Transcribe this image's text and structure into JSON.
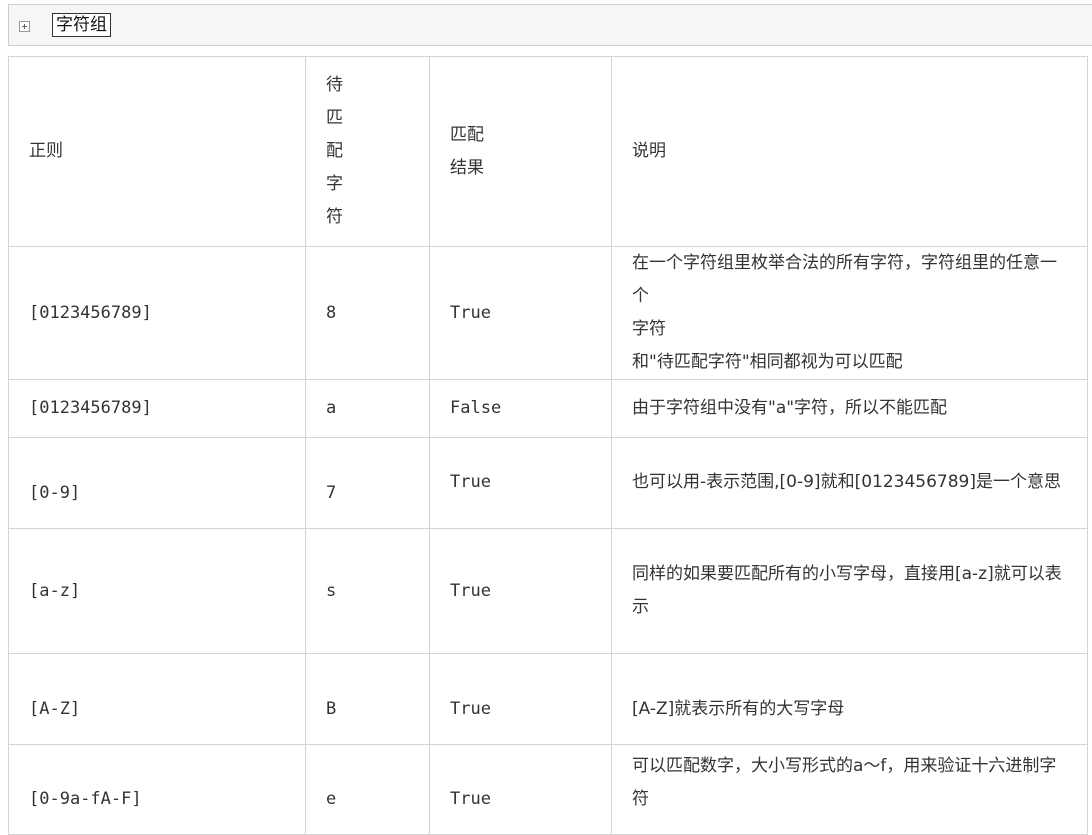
{
  "header": {
    "group_label": "字符组"
  },
  "table": {
    "headers": {
      "pattern": "正则",
      "char_chars": [
        "待",
        "匹",
        "配",
        "字",
        "符"
      ],
      "result_line1": "匹配",
      "result_line2": "结果",
      "description": "说明"
    },
    "rows": [
      {
        "pattern": "[0123456789]",
        "char": "8",
        "result": "True",
        "desc_lines": [
          "在一个字符组里枚举合法的所有字符，字符组里的任意一个",
          "字符",
          "和\"待匹配字符\"相同都视为可以匹配"
        ]
      },
      {
        "pattern": "[0123456789]",
        "char": "a",
        "result": "False",
        "desc_lines": [
          "由于字符组中没有\"a\"字符，所以不能匹配"
        ]
      },
      {
        "pattern": "[0-9]",
        "char": "7",
        "result": "True",
        "desc_lines": [
          "也可以用-表示范围,[0-9]就和[0123456789]是一个意思"
        ]
      },
      {
        "pattern": "[a-z]",
        "char": "s",
        "result": "True",
        "desc_lines": [
          "同样的如果要匹配所有的小写字母，直接用[a-z]就可以表",
          "示"
        ]
      },
      {
        "pattern": "[A-Z]",
        "char": "B",
        "result": "True",
        "desc_lines": [
          "[A-Z]就表示所有的大写字母"
        ]
      },
      {
        "pattern": "[0-9a-fA-F]",
        "char": "e",
        "result": "True",
        "desc_lines": [
          "可以匹配数字，大小写形式的a～f，用来验证十六进制字符"
        ]
      }
    ]
  }
}
